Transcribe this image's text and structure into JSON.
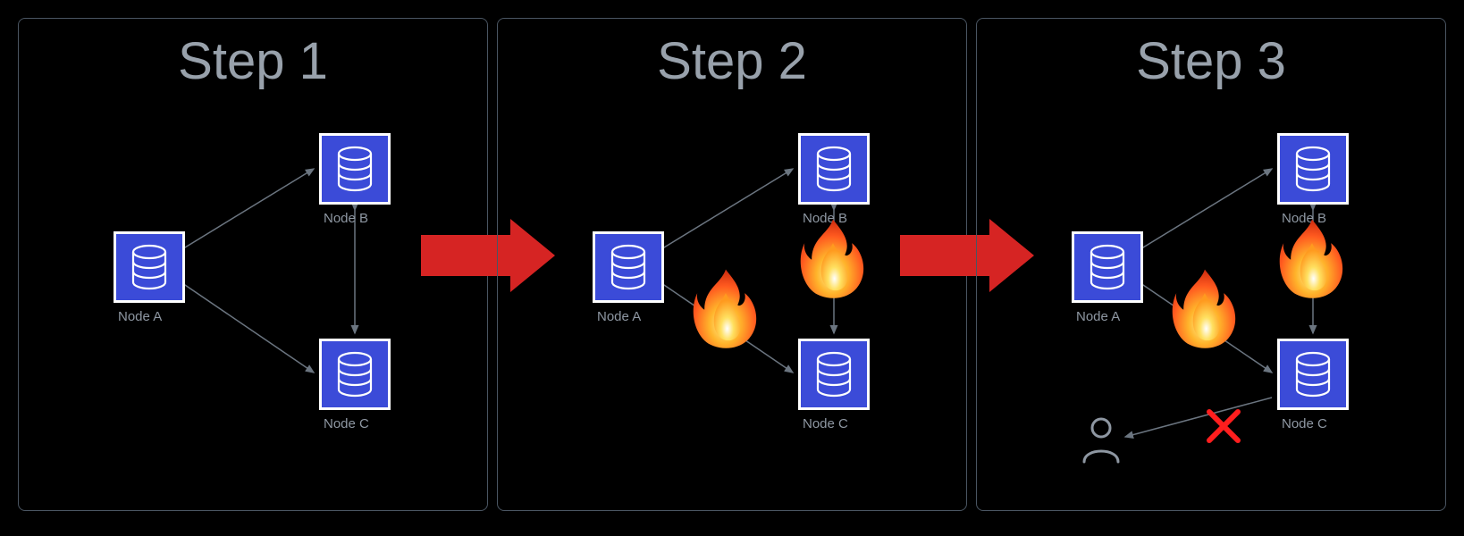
{
  "steps": [
    {
      "title": "Step 1"
    },
    {
      "title": "Step 2"
    },
    {
      "title": "Step 3"
    }
  ],
  "nodes": {
    "a": "Node A",
    "b": "Node B",
    "c": "Node C"
  },
  "colors": {
    "panel_border": "#4a5562",
    "title_text": "#98a1ab",
    "node_fill": "#3b4bd8",
    "arrow_red": "#d62423",
    "x_red": "#ff1e1e"
  }
}
